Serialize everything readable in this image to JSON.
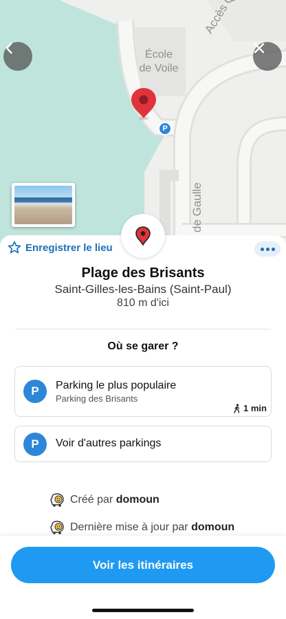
{
  "map": {
    "labels": {
      "ecole": "École\nde Voile",
      "acces_quai": "Accès Quai",
      "de_gaulle": "de Gaulle"
    },
    "parking_marker": "P",
    "icons": {
      "back": "chevron-left-icon",
      "close": "close-icon",
      "pin": "map-pin-icon"
    }
  },
  "actions": {
    "save_label": "Enregistrer le lieu",
    "more": "more-options-icon"
  },
  "place": {
    "title": "Plage des Brisants",
    "subtitle": "Saint-Gilles-les-Bains (Saint-Paul)",
    "distance": "810 m d'ici"
  },
  "parking": {
    "section_title": "Où se garer ?",
    "badge": "P",
    "popular": {
      "title": "Parking le plus populaire",
      "subtitle": "Parking des Brisants",
      "walk_time": "1 min"
    },
    "others": {
      "title": "Voir d'autres parkings"
    }
  },
  "meta": {
    "created_prefix": "Créé par",
    "created_by": "domoun",
    "updated_prefix": "Dernière mise à jour par",
    "updated_by": "domoun"
  },
  "footer": {
    "primary_label": "Voir les itinéraires"
  },
  "colors": {
    "accent": "#1f9af2",
    "link": "#1d6fb8",
    "parking": "#2e86d8",
    "pin": "#e0333b",
    "sea": "#bfe4dc"
  }
}
